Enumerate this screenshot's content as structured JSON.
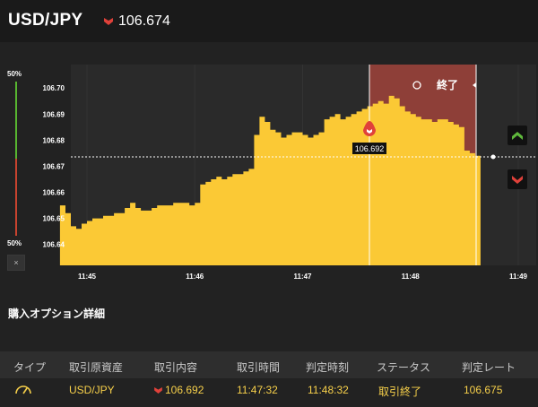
{
  "header": {
    "pair": "USD/JPY",
    "rate": "106.674",
    "direction_icon": "down-arrow-icon"
  },
  "indicator": {
    "top_pct": "50%",
    "bottom_pct": "50%",
    "close_label": "×"
  },
  "chart_data": {
    "type": "area",
    "y_ticks": [
      "106.70",
      "106.69",
      "106.68",
      "106.67",
      "106.66",
      "106.65",
      "106.64"
    ],
    "x_ticks": [
      "11:45",
      "11:46",
      "11:47",
      "11:48",
      "11:49"
    ],
    "ylim": [
      106.632,
      106.709
    ],
    "current_rate": 106.674,
    "entry_marker": {
      "time": "11:47:32",
      "rate": 106.692,
      "label": "106.692"
    },
    "judgement_time": "11:48:32",
    "expired_label": "終了",
    "series": [
      {
        "points": [
          [
            "11:44:45",
            106.655
          ],
          [
            "11:44:48",
            106.652
          ],
          [
            "11:44:51",
            106.647
          ],
          [
            "11:44:54",
            106.646
          ],
          [
            "11:44:57",
            106.648
          ],
          [
            "11:45:00",
            106.649
          ],
          [
            "11:45:03",
            106.65
          ],
          [
            "11:45:06",
            106.65
          ],
          [
            "11:45:09",
            106.651
          ],
          [
            "11:45:12",
            106.651
          ],
          [
            "11:45:15",
            106.652
          ],
          [
            "11:45:18",
            106.652
          ],
          [
            "11:45:21",
            106.654
          ],
          [
            "11:45:24",
            106.656
          ],
          [
            "11:45:27",
            106.654
          ],
          [
            "11:45:30",
            106.653
          ],
          [
            "11:45:33",
            106.653
          ],
          [
            "11:45:36",
            106.654
          ],
          [
            "11:45:39",
            106.655
          ],
          [
            "11:45:42",
            106.655
          ],
          [
            "11:45:45",
            106.655
          ],
          [
            "11:45:48",
            106.656
          ],
          [
            "11:45:51",
            106.656
          ],
          [
            "11:45:54",
            106.656
          ],
          [
            "11:45:57",
            106.655
          ],
          [
            "11:46:00",
            106.656
          ],
          [
            "11:46:03",
            106.663
          ],
          [
            "11:46:06",
            106.664
          ],
          [
            "11:46:09",
            106.665
          ],
          [
            "11:46:12",
            106.666
          ],
          [
            "11:46:15",
            106.665
          ],
          [
            "11:46:18",
            106.666
          ],
          [
            "11:46:21",
            106.667
          ],
          [
            "11:46:24",
            106.667
          ],
          [
            "11:46:27",
            106.668
          ],
          [
            "11:46:30",
            106.669
          ],
          [
            "11:46:33",
            106.682
          ],
          [
            "11:46:36",
            106.689
          ],
          [
            "11:46:39",
            106.687
          ],
          [
            "11:46:42",
            106.684
          ],
          [
            "11:46:45",
            106.683
          ],
          [
            "11:46:48",
            106.681
          ],
          [
            "11:46:51",
            106.682
          ],
          [
            "11:46:54",
            106.683
          ],
          [
            "11:46:57",
            106.683
          ],
          [
            "11:47:00",
            106.682
          ],
          [
            "11:47:03",
            106.681
          ],
          [
            "11:47:06",
            106.682
          ],
          [
            "11:47:09",
            106.683
          ],
          [
            "11:47:12",
            106.688
          ],
          [
            "11:47:15",
            106.689
          ],
          [
            "11:47:18",
            106.69
          ],
          [
            "11:47:21",
            106.688
          ],
          [
            "11:47:24",
            106.689
          ],
          [
            "11:47:27",
            106.69
          ],
          [
            "11:47:30",
            106.691
          ],
          [
            "11:47:33",
            106.692
          ],
          [
            "11:47:36",
            106.693
          ],
          [
            "11:47:39",
            106.694
          ],
          [
            "11:47:42",
            106.695
          ],
          [
            "11:47:45",
            106.694
          ],
          [
            "11:47:48",
            106.697
          ],
          [
            "11:47:51",
            106.696
          ],
          [
            "11:47:54",
            106.693
          ],
          [
            "11:47:57",
            106.691
          ],
          [
            "11:48:00",
            106.69
          ],
          [
            "11:48:03",
            106.689
          ],
          [
            "11:48:06",
            106.688
          ],
          [
            "11:48:09",
            106.688
          ],
          [
            "11:48:12",
            106.687
          ],
          [
            "11:48:15",
            106.688
          ],
          [
            "11:48:18",
            106.688
          ],
          [
            "11:48:21",
            106.687
          ],
          [
            "11:48:24",
            106.686
          ],
          [
            "11:48:27",
            106.685
          ],
          [
            "11:48:30",
            106.676
          ],
          [
            "11:48:33",
            106.675
          ],
          [
            "11:48:36",
            106.674
          ],
          [
            "11:48:39",
            106.674
          ]
        ]
      }
    ]
  },
  "details": {
    "section_title": "購入オプション詳細",
    "columns": [
      "タイプ",
      "取引原資産",
      "取引内容",
      "取引時間",
      "判定時刻",
      "ステータス",
      "判定レート"
    ],
    "row": {
      "type_icon": "gauge-icon",
      "asset": "USD/JPY",
      "direction_icon": "down-arrow-icon",
      "content": "106.692",
      "trade_time": "11:47:32",
      "judgement_time": "11:48:32",
      "status": "取引終了",
      "judgement_rate": "106.675"
    }
  },
  "colors": {
    "fill": "#fbc935",
    "expired_overlay": "#8e3f38",
    "down": "#e0413a",
    "up": "#5fb83c",
    "row_text": "#f7d04a"
  }
}
